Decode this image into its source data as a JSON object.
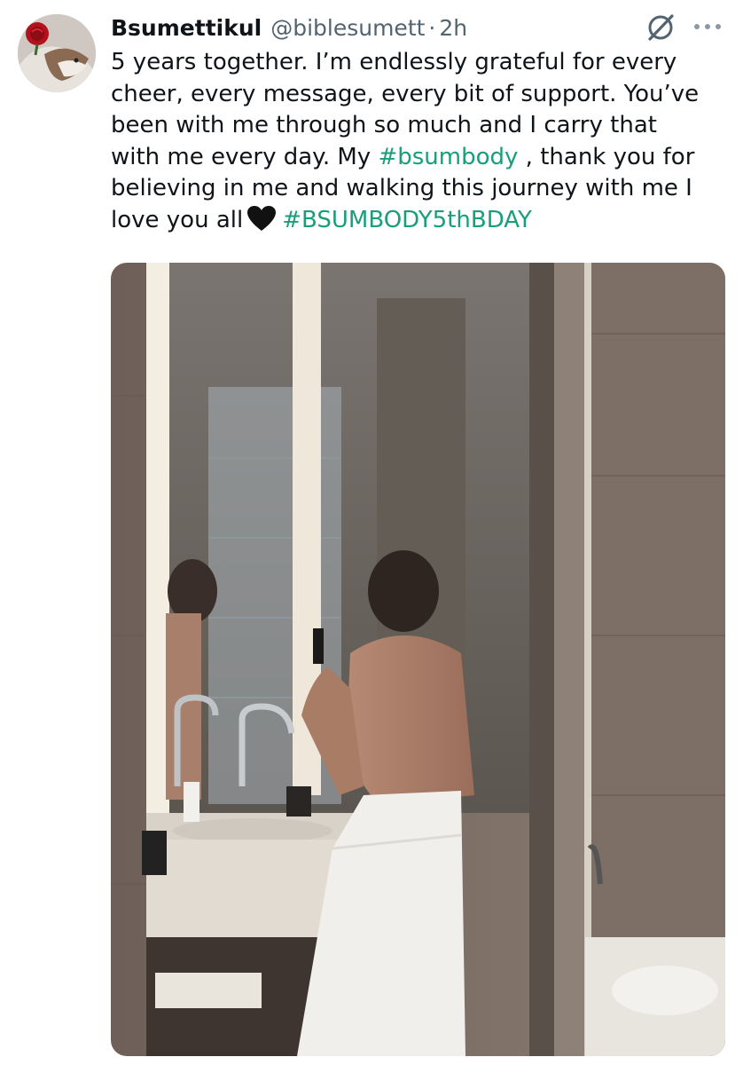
{
  "author": {
    "display_name": "Bsumettikul",
    "handle": "@biblesumett",
    "separator": "·",
    "timestamp": "2h",
    "avatar_icon": "avatar-rose-dog"
  },
  "tweet": {
    "lines": {
      "l1": "5 years together. I’m endlessly grateful for every",
      "l2": "cheer, every message, every bit of support. You’ve",
      "l3": "been with me through so much and I carry that",
      "l4_pre": "with me every day. My ",
      "hashtag1": "#bsumbody",
      "l4_post": " , thank you for",
      "l5": "believing in me and walking this journey with me I",
      "l6_pre": "love you all",
      "hashtag2": "#BSUMBODY5thBDAY"
    },
    "emoji": "black-heart",
    "hashtag_color": "#1a9e7a"
  },
  "actions": {
    "grok_icon": "grok-icon",
    "more_icon": "more-icon"
  },
  "media": {
    "type": "photo",
    "icon": "bathroom-mirror-selfie-photo"
  }
}
